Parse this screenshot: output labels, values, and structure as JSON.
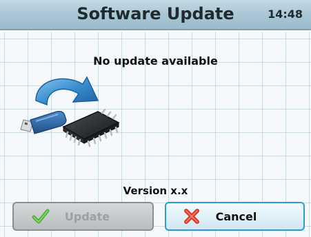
{
  "header": {
    "title": "Software Update",
    "clock": "14:48"
  },
  "main": {
    "status": "No update available",
    "version": "Version x.x"
  },
  "buttons": {
    "update_label": "Update",
    "update_icon": "checkmark-icon",
    "update_enabled": false,
    "cancel_label": "Cancel",
    "cancel_icon": "x-icon"
  },
  "illustration": {
    "icon": "usb-to-chip-update-icon"
  },
  "colors": {
    "titlebar": "#a8c5d3",
    "check_green": "#4caf3a",
    "cancel_red": "#d93a2c",
    "cancel_border": "#2a9cd2",
    "arrow_blue": "#2e7fc4"
  }
}
